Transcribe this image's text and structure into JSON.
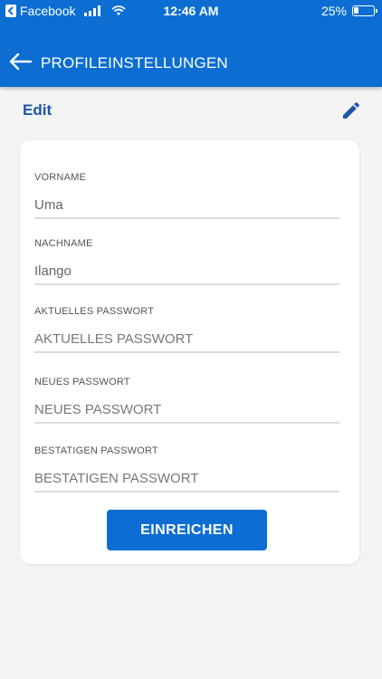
{
  "status_bar": {
    "back_app": "Facebook",
    "time": "12:46 AM",
    "battery_percent": "25%",
    "battery_level": 0.25,
    "icons": [
      "back-to-app-icon",
      "cellular-signal-icon",
      "wifi-icon",
      "battery-icon"
    ]
  },
  "app_bar": {
    "title": "PROFILEINSTELLUNGEN",
    "back_icon": "back-arrow-icon"
  },
  "edit_section": {
    "label": "Edit",
    "edit_icon": "pencil-icon"
  },
  "form": {
    "fields": [
      {
        "label": "VORNAME",
        "value": "Uma",
        "placeholder": ""
      },
      {
        "label": "NACHNAME",
        "value": "Ilango",
        "placeholder": ""
      },
      {
        "label": "AKTUELLES PASSWORT",
        "value": "",
        "placeholder": "AKTUELLES PASSWORT"
      },
      {
        "label": "NEUES PASSWORT",
        "value": "",
        "placeholder": "NEUES PASSWORT"
      },
      {
        "label": "BESTATIGEN PASSWORT",
        "value": "",
        "placeholder": "BESTATIGEN PASSWORT"
      }
    ],
    "submit_label": "EINREICHEN"
  },
  "colors": {
    "primary": "#0c6ed2",
    "edit_text": "#1f56a8",
    "background": "#f4f4f4",
    "card": "#ffffff"
  }
}
